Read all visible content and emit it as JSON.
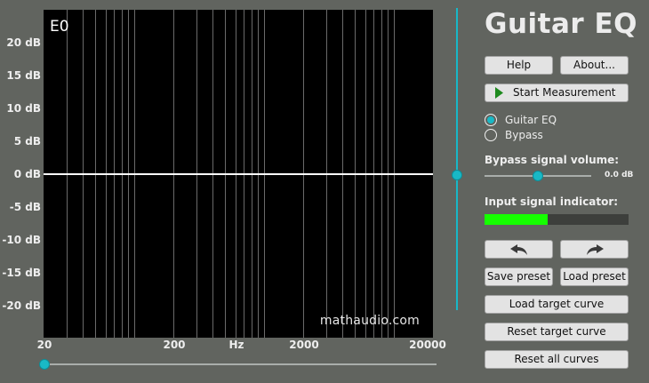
{
  "plot": {
    "note": "E0",
    "watermark": "mathaudio.com",
    "y_labels": [
      "20 dB",
      "15 dB",
      "10 dB",
      "5 dB",
      "0 dB",
      "-5 dB",
      "-10 dB",
      "-15 dB",
      "-20 dB"
    ],
    "x_labels": [
      "20",
      "200",
      "Hz",
      "2000",
      "20000"
    ],
    "freq_range_hz": [
      20,
      20000
    ],
    "gain_range_db": [
      -20,
      20
    ],
    "eq_curve_db": 0,
    "grid_color": "#6a6a6a",
    "curve_color": "#ffffff"
  },
  "sliders": {
    "gain_slider_value_db": 0,
    "frequency_slider_value_hz": 20,
    "accent": "#19b9c6"
  },
  "panel": {
    "title": "Guitar EQ",
    "help_label": "Help",
    "about_label": "About...",
    "start_label": "Start Measurement",
    "modes": [
      {
        "label": "Guitar EQ",
        "checked": true
      },
      {
        "label": "Bypass",
        "checked": false
      }
    ],
    "bypass_volume_label": "Bypass signal volume:",
    "bypass_volume_value": "0.0 dB",
    "bypass_volume_fraction": 0.5,
    "input_indicator_label": "Input signal indicator:",
    "input_level_fraction": 0.44,
    "input_level_color": "#15ff00",
    "undo_icon": "undo-arrow-icon",
    "redo_icon": "redo-arrow-icon",
    "save_preset_label": "Save preset",
    "load_preset_label": "Load preset",
    "load_target_label": "Load target curve",
    "reset_target_label": "Reset target curve",
    "reset_all_label": "Reset all curves"
  }
}
